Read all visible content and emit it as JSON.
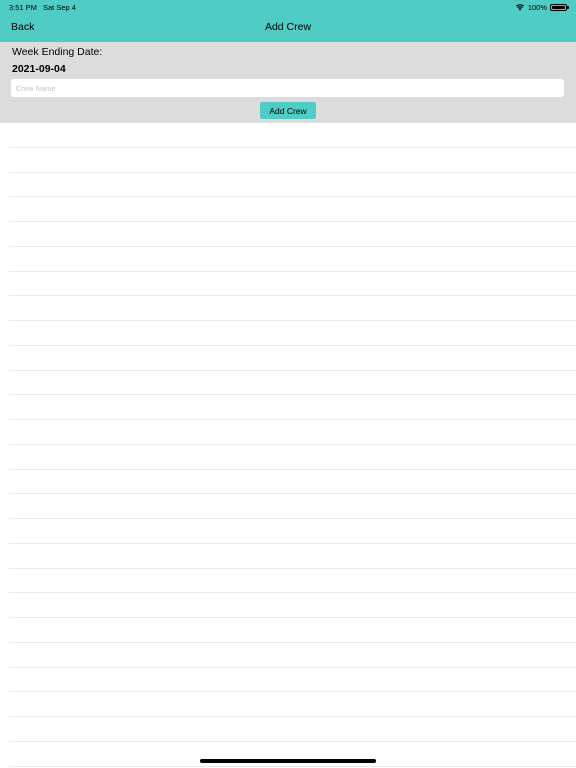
{
  "status_bar": {
    "time": "3:51 PM",
    "date": "Sat Sep 4",
    "battery": "100%",
    "icons": [
      "wifi-icon",
      "battery-icon"
    ]
  },
  "nav": {
    "back_label": "Back",
    "title": "Add Crew"
  },
  "form": {
    "week_label": "Week Ending Date:",
    "week_value": "2021-09-04",
    "crew_name_placeholder": "Crew Name",
    "crew_name_value": "",
    "add_button_label": "Add Crew"
  },
  "crew_list": {
    "rows": []
  },
  "colors": {
    "accent": "#4fcdc4",
    "panel_bg": "#dcdcdc",
    "row_divider": "#ececec"
  }
}
